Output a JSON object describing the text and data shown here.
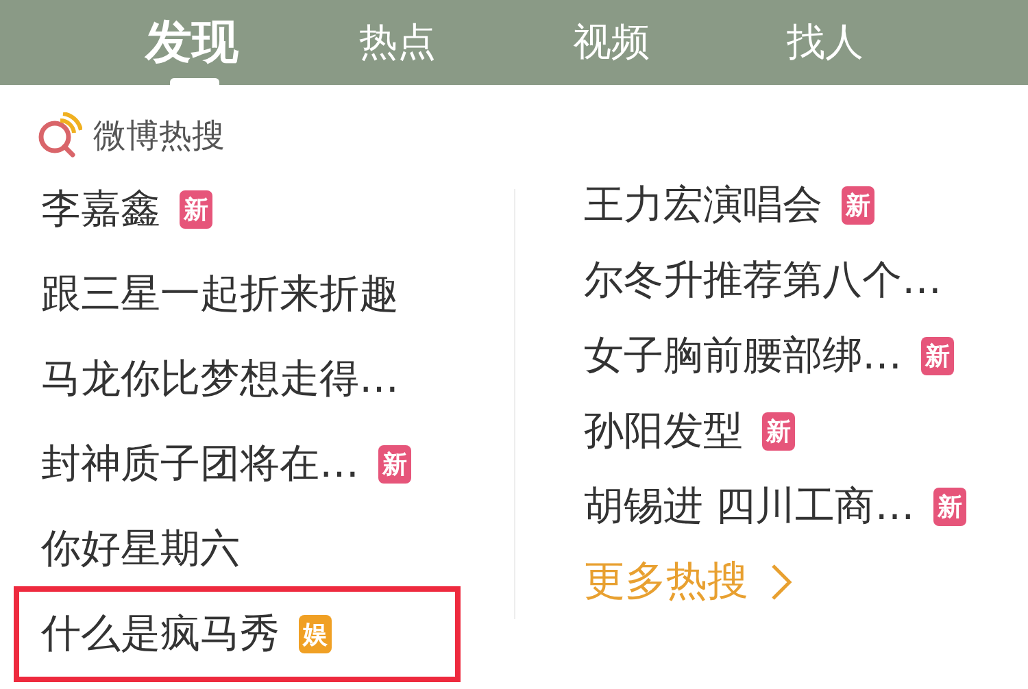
{
  "tabs": [
    {
      "label": "发现",
      "selected": true
    },
    {
      "label": "热点",
      "selected": false
    },
    {
      "label": "视频",
      "selected": false
    },
    {
      "label": "找人",
      "selected": false
    }
  ],
  "hot_search": {
    "title": "微博热搜",
    "left_items": [
      {
        "text": "李嘉鑫",
        "badge": {
          "kind": "new",
          "label": "新"
        },
        "highlighted": false
      },
      {
        "text": "跟三星一起折来折趣",
        "highlighted": false
      },
      {
        "text": "马龙你比梦想走得…",
        "highlighted": false
      },
      {
        "text": "封神质子团将在…",
        "badge": {
          "kind": "new",
          "label": "新"
        },
        "highlighted": false
      },
      {
        "text": "你好星期六",
        "highlighted": false
      },
      {
        "text": "什么是疯马秀",
        "badge": {
          "kind": "entertainment",
          "label": "娱"
        },
        "highlighted": true
      }
    ],
    "right_items": [
      {
        "text": "王力宏演唱会",
        "badge": {
          "kind": "new",
          "label": "新"
        }
      },
      {
        "text": "尔冬升推荐第八个…"
      },
      {
        "text": "女子胸前腰部绑…",
        "badge": {
          "kind": "new",
          "label": "新"
        }
      },
      {
        "text": "孙阳发型",
        "badge": {
          "kind": "new",
          "label": "新"
        }
      },
      {
        "text": "胡锡进 四川工商…",
        "badge": {
          "kind": "new",
          "label": "新"
        }
      }
    ],
    "more_link": "更多热搜"
  }
}
